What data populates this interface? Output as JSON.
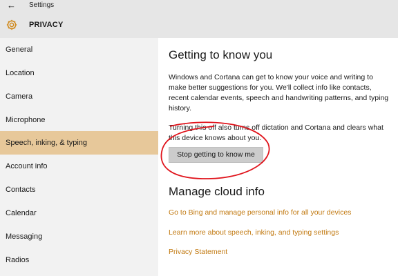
{
  "window": {
    "title": "Settings"
  },
  "header": {
    "title": "PRIVACY"
  },
  "sidebar": {
    "items": [
      {
        "label": "General"
      },
      {
        "label": "Location"
      },
      {
        "label": "Camera"
      },
      {
        "label": "Microphone"
      },
      {
        "label": "Speech, inking, & typing",
        "selected": true
      },
      {
        "label": "Account info"
      },
      {
        "label": "Contacts"
      },
      {
        "label": "Calendar"
      },
      {
        "label": "Messaging"
      },
      {
        "label": "Radios"
      }
    ]
  },
  "main": {
    "section1": {
      "heading": "Getting to know you",
      "description": "Windows and Cortana can get to know your voice and writing to make better suggestions for you. We'll collect info like contacts, recent calendar events, speech and handwriting patterns, and typing history.",
      "note": "Turning this off also turns off dictation and Cortana and clears what this device knows about you.",
      "button_label": "Stop getting to know me"
    },
    "section2": {
      "heading": "Manage cloud info",
      "links": [
        {
          "label": "Go to Bing and manage personal info for all your devices"
        },
        {
          "label": "Learn more about speech, inking, and typing settings"
        },
        {
          "label": "Privacy Statement"
        }
      ]
    }
  },
  "colors": {
    "selected_background": "#e7c89a",
    "accent_link": "#c27a12",
    "gear_icon": "#d08a1e",
    "annotation_circle": "#e0141c"
  },
  "icons": {
    "back": "back-arrow-icon",
    "settings": "gear-icon"
  }
}
